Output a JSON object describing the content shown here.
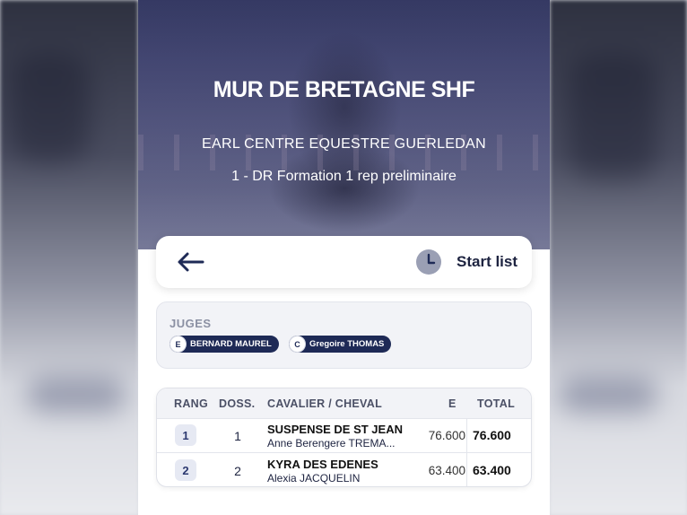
{
  "hero": {
    "title": "MUR DE BRETAGNE SHF",
    "organizer": "EARL CENTRE EQUESTRE GUERLEDAN",
    "event": "1 - DR Formation 1 rep preliminaire"
  },
  "nav": {
    "back_icon": "arrow-left-icon",
    "clock_icon": "clock-icon",
    "start_list_label": "Start list"
  },
  "judges": {
    "title": "JUGES",
    "items": [
      {
        "letter": "E",
        "name": "BERNARD MAUREL"
      },
      {
        "letter": "C",
        "name": "Gregoire THOMAS"
      }
    ]
  },
  "results": {
    "headers": {
      "rank": "RANG",
      "doss": "DOSS.",
      "rider_horse": "CAVALIER / CHEVAL",
      "e": "E",
      "total": "TOTAL"
    },
    "rows": [
      {
        "rank": "1",
        "doss": "1",
        "horse": "SUSPENSE DE ST JEAN",
        "rider": "Anne Berengere TREMA...",
        "e": "76.600",
        "total": "76.600"
      },
      {
        "rank": "2",
        "doss": "2",
        "horse": "KYRA DES EDENES",
        "rider": "Alexia JACQUELIN",
        "e": "63.400",
        "total": "63.400"
      }
    ]
  },
  "colors": {
    "navy": "#1e2a56",
    "text_dark": "#1d2340",
    "muted": "#8b90a3",
    "panel": "#f2f3f7"
  }
}
